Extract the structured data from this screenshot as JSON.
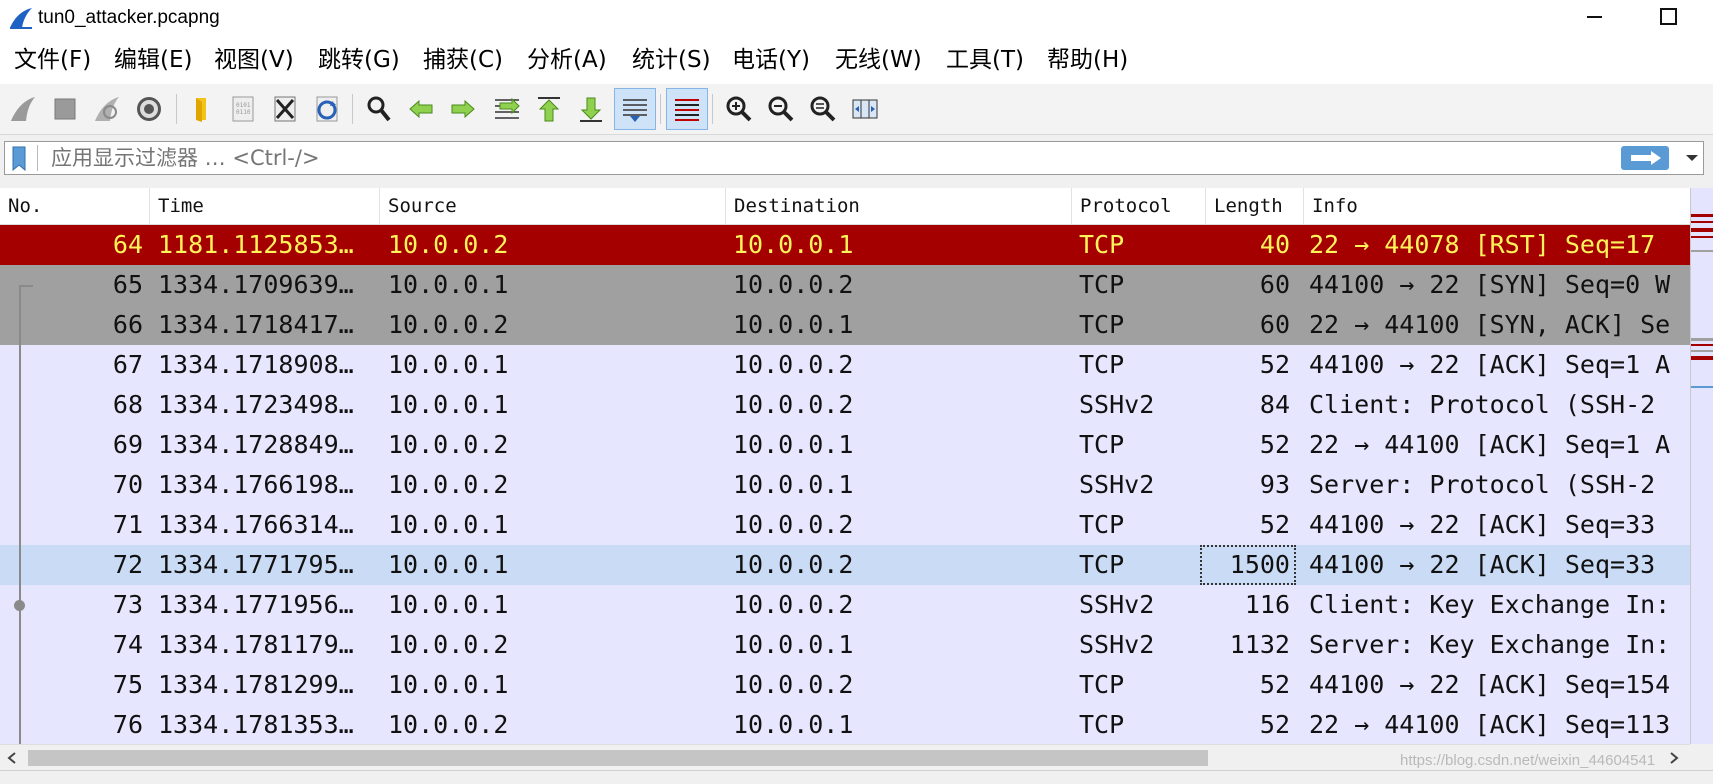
{
  "window": {
    "title": "tun0_attacker.pcapng"
  },
  "menu": [
    "文件(F)",
    "编辑(E)",
    "视图(V)",
    "跳转(G)",
    "捕获(C)",
    "分析(A)",
    "统计(S)",
    "电话(Y)",
    "无线(W)",
    "工具(T)",
    "帮助(H)"
  ],
  "toolbar": {
    "icons": [
      "shark-fin-start-icon",
      "stop-square-icon",
      "restart-capture-icon",
      "capture-options-gear-icon",
      "open-folder-icon",
      "save-file-icon",
      "close-file-icon",
      "reload-file-icon",
      "find-packet-icon",
      "go-back-arrow-icon",
      "go-forward-arrow-icon",
      "go-to-packet-icon",
      "first-packet-icon",
      "last-packet-icon",
      "auto-scroll-icon",
      "colorize-list-icon",
      "zoom-in-icon",
      "zoom-out-icon",
      "normal-size-icon",
      "resize-columns-icon"
    ]
  },
  "filter": {
    "placeholder": "应用显示过滤器 … <Ctrl-/>"
  },
  "columns": [
    "No.",
    "Time",
    "Source",
    "Destination",
    "Protocol",
    "Length",
    "Info"
  ],
  "packets": [
    {
      "no": "64",
      "time": "1181.1125853…",
      "src": "10.0.0.2",
      "dst": "10.0.0.1",
      "proto": "TCP",
      "len": "40",
      "info": "22 → 44078 [RST] Seq=17",
      "style": "rst"
    },
    {
      "no": "65",
      "time": "1334.1709639…",
      "src": "10.0.0.1",
      "dst": "10.0.0.2",
      "proto": "TCP",
      "len": "60",
      "info": "44100 → 22 [SYN] Seq=0 W",
      "style": "syn"
    },
    {
      "no": "66",
      "time": "1334.1718417…",
      "src": "10.0.0.2",
      "dst": "10.0.0.1",
      "proto": "TCP",
      "len": "60",
      "info": "22 → 44100 [SYN, ACK] Se",
      "style": "syn"
    },
    {
      "no": "67",
      "time": "1334.1718908…",
      "src": "10.0.0.1",
      "dst": "10.0.0.2",
      "proto": "TCP",
      "len": "52",
      "info": "44100 → 22 [ACK] Seq=1 A",
      "style": "ssh"
    },
    {
      "no": "68",
      "time": "1334.1723498…",
      "src": "10.0.0.1",
      "dst": "10.0.0.2",
      "proto": "SSHv2",
      "len": "84",
      "info": "Client: Protocol (SSH-2",
      "style": "ssh"
    },
    {
      "no": "69",
      "time": "1334.1728849…",
      "src": "10.0.0.2",
      "dst": "10.0.0.1",
      "proto": "TCP",
      "len": "52",
      "info": "22 → 44100 [ACK] Seq=1 A",
      "style": "ssh"
    },
    {
      "no": "70",
      "time": "1334.1766198…",
      "src": "10.0.0.2",
      "dst": "10.0.0.1",
      "proto": "SSHv2",
      "len": "93",
      "info": "Server: Protocol (SSH-2",
      "style": "ssh"
    },
    {
      "no": "71",
      "time": "1334.1766314…",
      "src": "10.0.0.1",
      "dst": "10.0.0.2",
      "proto": "TCP",
      "len": "52",
      "info": "44100 → 22 [ACK] Seq=33",
      "style": "ssh"
    },
    {
      "no": "72",
      "time": "1334.1771795…",
      "src": "10.0.0.1",
      "dst": "10.0.0.2",
      "proto": "TCP",
      "len": "1500",
      "info": "44100 → 22 [ACK] Seq=33",
      "style": "sel"
    },
    {
      "no": "73",
      "time": "1334.1771956…",
      "src": "10.0.0.1",
      "dst": "10.0.0.2",
      "proto": "SSHv2",
      "len": "116",
      "info": "Client: Key Exchange In:",
      "style": "ssh"
    },
    {
      "no": "74",
      "time": "1334.1781179…",
      "src": "10.0.0.2",
      "dst": "10.0.0.1",
      "proto": "SSHv2",
      "len": "1132",
      "info": "Server: Key Exchange In:",
      "style": "ssh"
    },
    {
      "no": "75",
      "time": "1334.1781299…",
      "src": "10.0.0.1",
      "dst": "10.0.0.2",
      "proto": "TCP",
      "len": "52",
      "info": "44100 → 22 [ACK] Seq=154",
      "style": "ssh"
    },
    {
      "no": "76",
      "time": "1334.1781353…",
      "src": "10.0.0.2",
      "dst": "10.0.0.1",
      "proto": "TCP",
      "len": "52",
      "info": "22 → 44100 [ACK] Seq=113",
      "style": "ssh"
    }
  ],
  "colors": {
    "rst_bg": "#a40000",
    "rst_fg": "#fff35c",
    "syn_bg": "#a0a0a0",
    "tcp_bg": "#e7e6ff",
    "selected_bg": "#c9dbf5"
  },
  "watermark": "https://blog.csdn.net/weixin_44604541"
}
